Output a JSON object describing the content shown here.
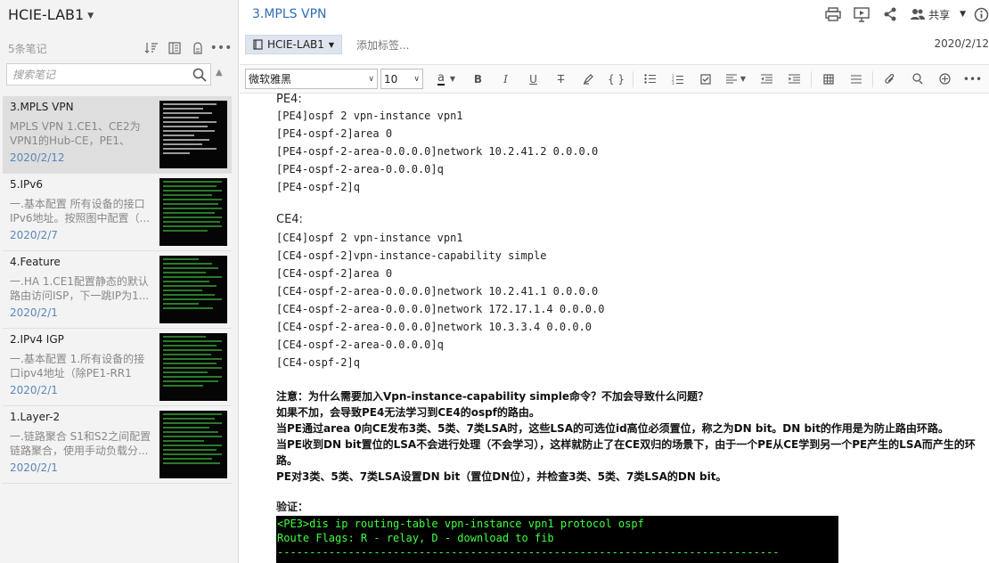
{
  "sidebar": {
    "notebook_title": "HCIE-LAB1",
    "count": "5条笔记",
    "search_placeholder": "搜索笔记",
    "notes": [
      {
        "title": "3.MPLS VPN",
        "snippet": "MPLS VPN 1.CE1、CE2为VPN1的Hub-CE，PE1、PE...",
        "date": "2020/2/12"
      },
      {
        "title": "5.IPv6",
        "snippet": "一.基本配置 所有设备的接口IPv6地址。按照图中配置（...",
        "date": "2020/2/7"
      },
      {
        "title": "4.Feature",
        "snippet": "一.HA 1.CE1配置静态的默认路由访问ISP，下一跳IP为1...",
        "date": "2020/2/1"
      },
      {
        "title": "2.IPv4 IGP",
        "snippet": "一.基本配置 1.所有设备的接口ipv4地址（除PE1-RR1的...",
        "date": "2020/2/1"
      },
      {
        "title": "1.Layer-2",
        "snippet": "一.链路聚合 S1和S2之间配置链路聚合，使用手动负载分...",
        "date": "2020/2/1"
      }
    ]
  },
  "header": {
    "doc_title": "3.MPLS VPN",
    "share_label": "共享",
    "notebook_button": "HCIE-LAB1",
    "add_tag": "添加标签...",
    "date": "2020/2/12"
  },
  "toolbar": {
    "font_family": "微软雅黑",
    "font_size": "10",
    "font_color_glyph": "a"
  },
  "content": {
    "pe4_label": "PE4:",
    "pe4_code": "[PE4]ospf 2 vpn-instance vpn1\n[PE4-ospf-2]area 0\n[PE4-ospf-2-area-0.0.0.0]network 10.2.41.2 0.0.0.0\n[PE4-ospf-2-area-0.0.0.0]q\n[PE4-ospf-2]q",
    "ce4_label": "CE4:",
    "ce4_code": "[CE4]ospf 2 vpn-instance vpn1\n[CE4-ospf-2]vpn-instance-capability simple\n[CE4-ospf-2]area 0\n[CE4-ospf-2-area-0.0.0.0]network 10.2.41.1 0.0.0.0\n[CE4-ospf-2-area-0.0.0.0]network 172.17.1.4 0.0.0.0\n[CE4-ospf-2-area-0.0.0.0]network 10.3.3.4 0.0.0.0\n[CE4-ospf-2-area-0.0.0.0]q\n[CE4-ospf-2]q",
    "note_lines": [
      "注意：为什么需要加入Vpn-instance-capability simple命令？不加会导致什么问题？",
      "如果不加，会导致PE4无法学习到CE4的ospf的路由。",
      "当PE通过area 0向CE发布3类、5类、7类LSA时，这些LSA的可选位id高位必须置位，称之为DN bit。DN bit的作用是为防止路由环路。",
      "当PE收到DN bit置位的LSA不会进行处理（不会学习），这样就防止了在CE双归的场景下，由于一个PE从CE学到另一个PE产生的LSA而产生的环路。",
      "PE对3类、5类、7类LSA设置DN bit（置位DN位），并检查3类、5类、7类LSA的DN bit。"
    ],
    "verify_label": "验证：",
    "terminal": "<PE3>dis ip routing-table vpn-instance vpn1 protocol ospf\nRoute Flags: R - relay, D - download to fib\n------------------------------------------------------------------------------"
  },
  "colors": {
    "accent": "#2f6db5",
    "terminal_bg": "#000000",
    "terminal_fg": "#40ff40",
    "date": "#5a86b8"
  }
}
